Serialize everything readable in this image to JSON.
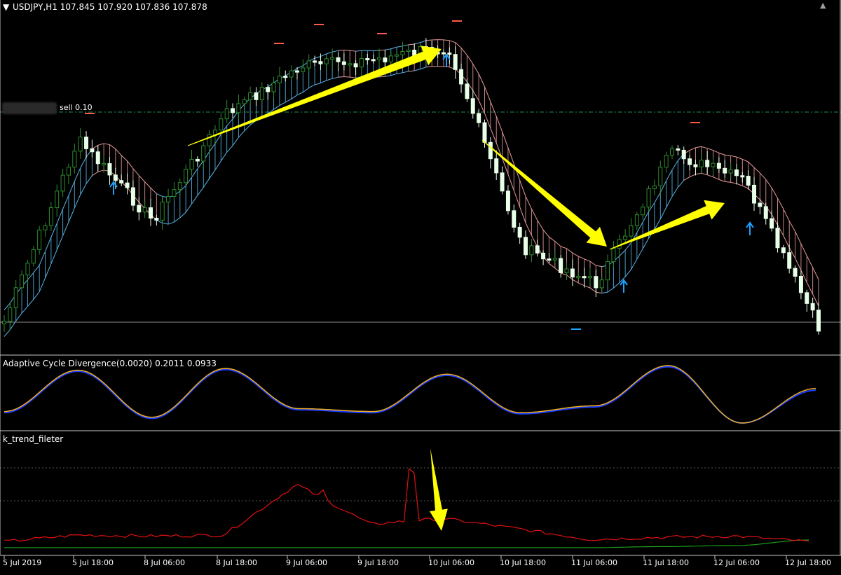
{
  "header": {
    "symbol_line": "USDJPY,H1  107.845 107.920 107.836 107.878"
  },
  "order_line": {
    "label": "sell 0.10",
    "price_level": 0.1
  },
  "panels": {
    "osc_title": "Adaptive Cycle Divergence(0.0020) 0.2011 0.0933",
    "filter_title": "k_trend_fileter"
  },
  "x_axis_labels": [
    "5 Jul 2019",
    "5 Jul 18:00",
    "8 Jul 06:00",
    "8 Jul 18:00",
    "9 Jul 06:00",
    "9 Jul 18:00",
    "10 Jul 06:00",
    "10 Jul 18:00",
    "11 Jul 06:00",
    "11 Jul 18:00",
    "12 Jul 06:00",
    "12 Jul 18:00"
  ],
  "colors": {
    "background": "#000000",
    "bull_candle": "#2e8b2e",
    "bear_candle": "#e8ffe8",
    "cloud_up": "#5ab4e6",
    "cloud_down": "#e89a9a",
    "osc_main": "#f0b020",
    "osc_signal": "#1a3cff",
    "filter_red": "#e01010",
    "filter_green": "#1c9c1c",
    "annotation_arrow": "#ffff00",
    "buy_arrow": "#1ea0ff"
  },
  "chart_data": [
    {
      "type": "candlestick",
      "title": "USDJPY,H1",
      "symbol": "USDJPY",
      "timeframe": "H1",
      "last_quote": {
        "open": 107.845,
        "high": 107.92,
        "low": 107.836,
        "close": 107.878
      },
      "x": [
        "5 Jul 2019",
        "5 Jul 18:00",
        "8 Jul 06:00",
        "8 Jul 18:00",
        "9 Jul 06:00",
        "9 Jul 18:00",
        "10 Jul 06:00",
        "10 Jul 18:00",
        "11 Jul 06:00",
        "11 Jul 18:00",
        "12 Jul 06:00",
        "12 Jul 18:00"
      ],
      "close_profile": [
        0.08,
        0.62,
        0.38,
        0.7,
        0.84,
        0.86,
        0.9,
        0.3,
        0.19,
        0.58,
        0.5,
        0.06
      ],
      "annotations": [
        "up arrow 5 Jul 21:00 to 10 Jul 00:00",
        "down arrow 10 Jul 06:00 to 11 Jul 03:00",
        "up arrow 11 Jul 03:00 to 12 Jul 06:00"
      ]
    },
    {
      "type": "line",
      "title": "Adaptive Cycle Divergence(0.0020)",
      "values_shown": [
        0.2011,
        0.0933
      ],
      "x": [
        "5 Jul 2019",
        "5 Jul 18:00",
        "8 Jul 06:00",
        "8 Jul 18:00",
        "9 Jul 06:00",
        "9 Jul 18:00",
        "10 Jul 06:00",
        "10 Jul 18:00",
        "11 Jul 06:00",
        "11 Jul 18:00",
        "12 Jul 06:00",
        "12 Jul 18:00"
      ],
      "series": [
        {
          "values": [
            0.2,
            0.92,
            0.1,
            0.95,
            0.25,
            0.2,
            0.85,
            0.18,
            0.3,
            1.0,
            0.0,
            0.6
          ]
        },
        {
          "values": [
            0.18,
            0.9,
            0.08,
            0.93,
            0.23,
            0.18,
            0.83,
            0.16,
            0.28,
            0.98,
            0.0,
            0.57
          ]
        }
      ]
    },
    {
      "type": "line",
      "title": "k_trend_fileter",
      "x": [
        "5 Jul 2019",
        "5 Jul 18:00",
        "8 Jul 06:00",
        "8 Jul 18:00",
        "9 Jul 06:00",
        "9 Jul 18:00",
        "10 Jul 06:00",
        "10 Jul 18:00",
        "11 Jul 06:00",
        "11 Jul 18:00",
        "12 Jul 06:00",
        "12 Jul 18:00"
      ],
      "series": [
        {
          "values": [
            0.04,
            0.1,
            0.09,
            0.1,
            0.56,
            0.2,
            0.25,
            0.16,
            0.06,
            0.08,
            0.09,
            0.04
          ]
        },
        {
          "values": [
            0.0,
            0.0,
            0.0,
            0.0,
            0.0,
            0.0,
            0.0,
            0.0,
            0.0,
            0.01,
            0.02,
            0.07
          ]
        }
      ],
      "peak_value": 1.0,
      "grid": "dotted"
    }
  ]
}
